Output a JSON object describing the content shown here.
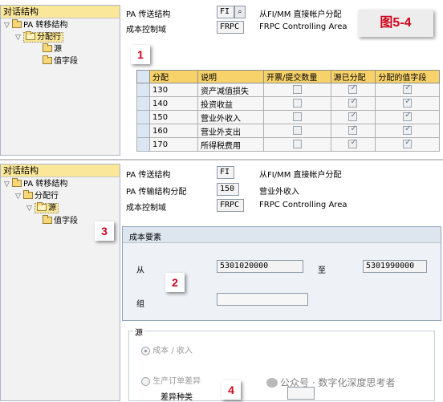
{
  "tree_top": {
    "title": "对话结构",
    "items": [
      "PA 转移结构",
      "分配行",
      "源",
      "值字段"
    ]
  },
  "tree_bottom": {
    "title": "对话结构",
    "items": [
      "PA 转移结构",
      "分配行",
      "源",
      "值字段"
    ]
  },
  "header_top": {
    "pa_label": "PA 传送结构",
    "pa_value": "FI",
    "pa_desc": "从FI/MM 直接帐户分配",
    "co_label": "成本控制域",
    "co_value": "FRPC",
    "co_desc": "FRPC Controlling Area"
  },
  "figure_label": "图5-4",
  "badges": [
    "1",
    "2",
    "3",
    "4"
  ],
  "table": {
    "columns": [
      "分配",
      "说明",
      "开票/提交数量",
      "源已分配",
      "分配的值字段"
    ],
    "rows": [
      {
        "id": "130",
        "desc": "资产减值损失",
        "billing": false,
        "src": true,
        "val": true
      },
      {
        "id": "140",
        "desc": "投资收益",
        "billing": false,
        "src": true,
        "val": true
      },
      {
        "id": "150",
        "desc": "营业外收入",
        "billing": false,
        "src": true,
        "val": true
      },
      {
        "id": "160",
        "desc": "营业外支出",
        "billing": false,
        "src": true,
        "val": true
      },
      {
        "id": "170",
        "desc": "所得税费用",
        "billing": false,
        "src": true,
        "val": true
      }
    ]
  },
  "header_bottom": {
    "pa_label": "PA 传送结构",
    "pa_value": "FI",
    "pa_desc": "从FI/MM 直接帐户分配",
    "assign_label": "PA 传输结构分配",
    "assign_value": "150",
    "assign_desc": "营业外收入",
    "co_label": "成本控制域",
    "co_value": "FRPC",
    "co_desc": "FRPC Controlling Area"
  },
  "cost_element": {
    "title": "成本要素",
    "from_label": "从",
    "from_value": "5301020000",
    "to_label": "至",
    "to_value": "5301990000",
    "group_label": "组",
    "group_value": ""
  },
  "source": {
    "title": "源",
    "radio1": "成本 / 收入",
    "radio2": "生产订单差异",
    "variance_label": "差异种类"
  },
  "watermark": "公众号 · 数字化深度思考者"
}
